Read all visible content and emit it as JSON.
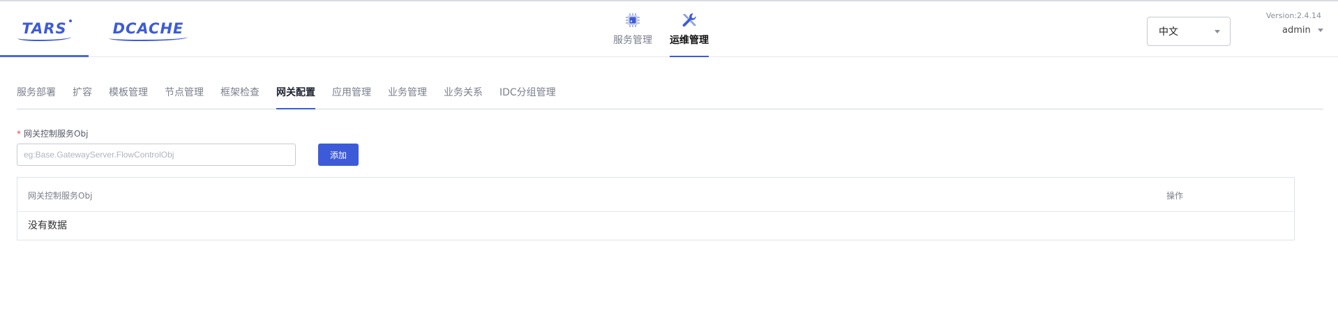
{
  "header": {
    "logos": [
      {
        "label": "TARS"
      },
      {
        "label": "DCACHE"
      }
    ],
    "nav": [
      {
        "label": "服务管理",
        "icon": "chip-icon"
      },
      {
        "label": "运维管理",
        "icon": "wrench-icon"
      }
    ],
    "language": {
      "selected": "中文"
    },
    "version": "Version:2.4.14",
    "user": "admin"
  },
  "subtabs": [
    {
      "label": "服务部署"
    },
    {
      "label": "扩容"
    },
    {
      "label": "模板管理"
    },
    {
      "label": "节点管理"
    },
    {
      "label": "框架检查"
    },
    {
      "label": "网关配置",
      "active": true
    },
    {
      "label": "应用管理"
    },
    {
      "label": "业务管理"
    },
    {
      "label": "业务关系"
    },
    {
      "label": "IDC分组管理"
    }
  ],
  "form": {
    "required_mark": "*",
    "label": "网关控制服务Obj",
    "placeholder": "eg:Base.GatewayServer.FlowControlObj",
    "add_label": "添加"
  },
  "table": {
    "columns": [
      "网关控制服务Obj",
      "操作"
    ],
    "empty_text": "没有数据"
  },
  "colors": {
    "accent": "#3d5bd9",
    "required": "#e5484d"
  }
}
